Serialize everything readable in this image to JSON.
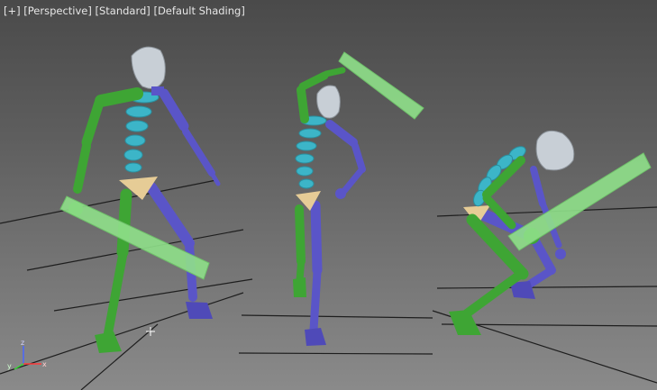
{
  "viewport": {
    "label_menu": "[+]",
    "label_view": "[Perspective]",
    "label_preset": "[Standard]",
    "label_shading": "[Default Shading]"
  },
  "axis_gizmo": {
    "x": "x",
    "y": "y",
    "z": "z"
  },
  "colors": {
    "left_limbs": "#3ea534",
    "right_limbs": "#5a55c8",
    "spine": "#3cb5c8",
    "pelvis": "#e6cc96",
    "head": "#c8cfd6",
    "prop": "#8fe08a",
    "grid_line": "#1e1e1e"
  },
  "figures": [
    {
      "name": "figure-left",
      "pose": "standing with prop in right hand"
    },
    {
      "name": "figure-middle",
      "pose": "standing with raised prop"
    },
    {
      "name": "figure-right",
      "pose": "crouching with prop"
    }
  ]
}
